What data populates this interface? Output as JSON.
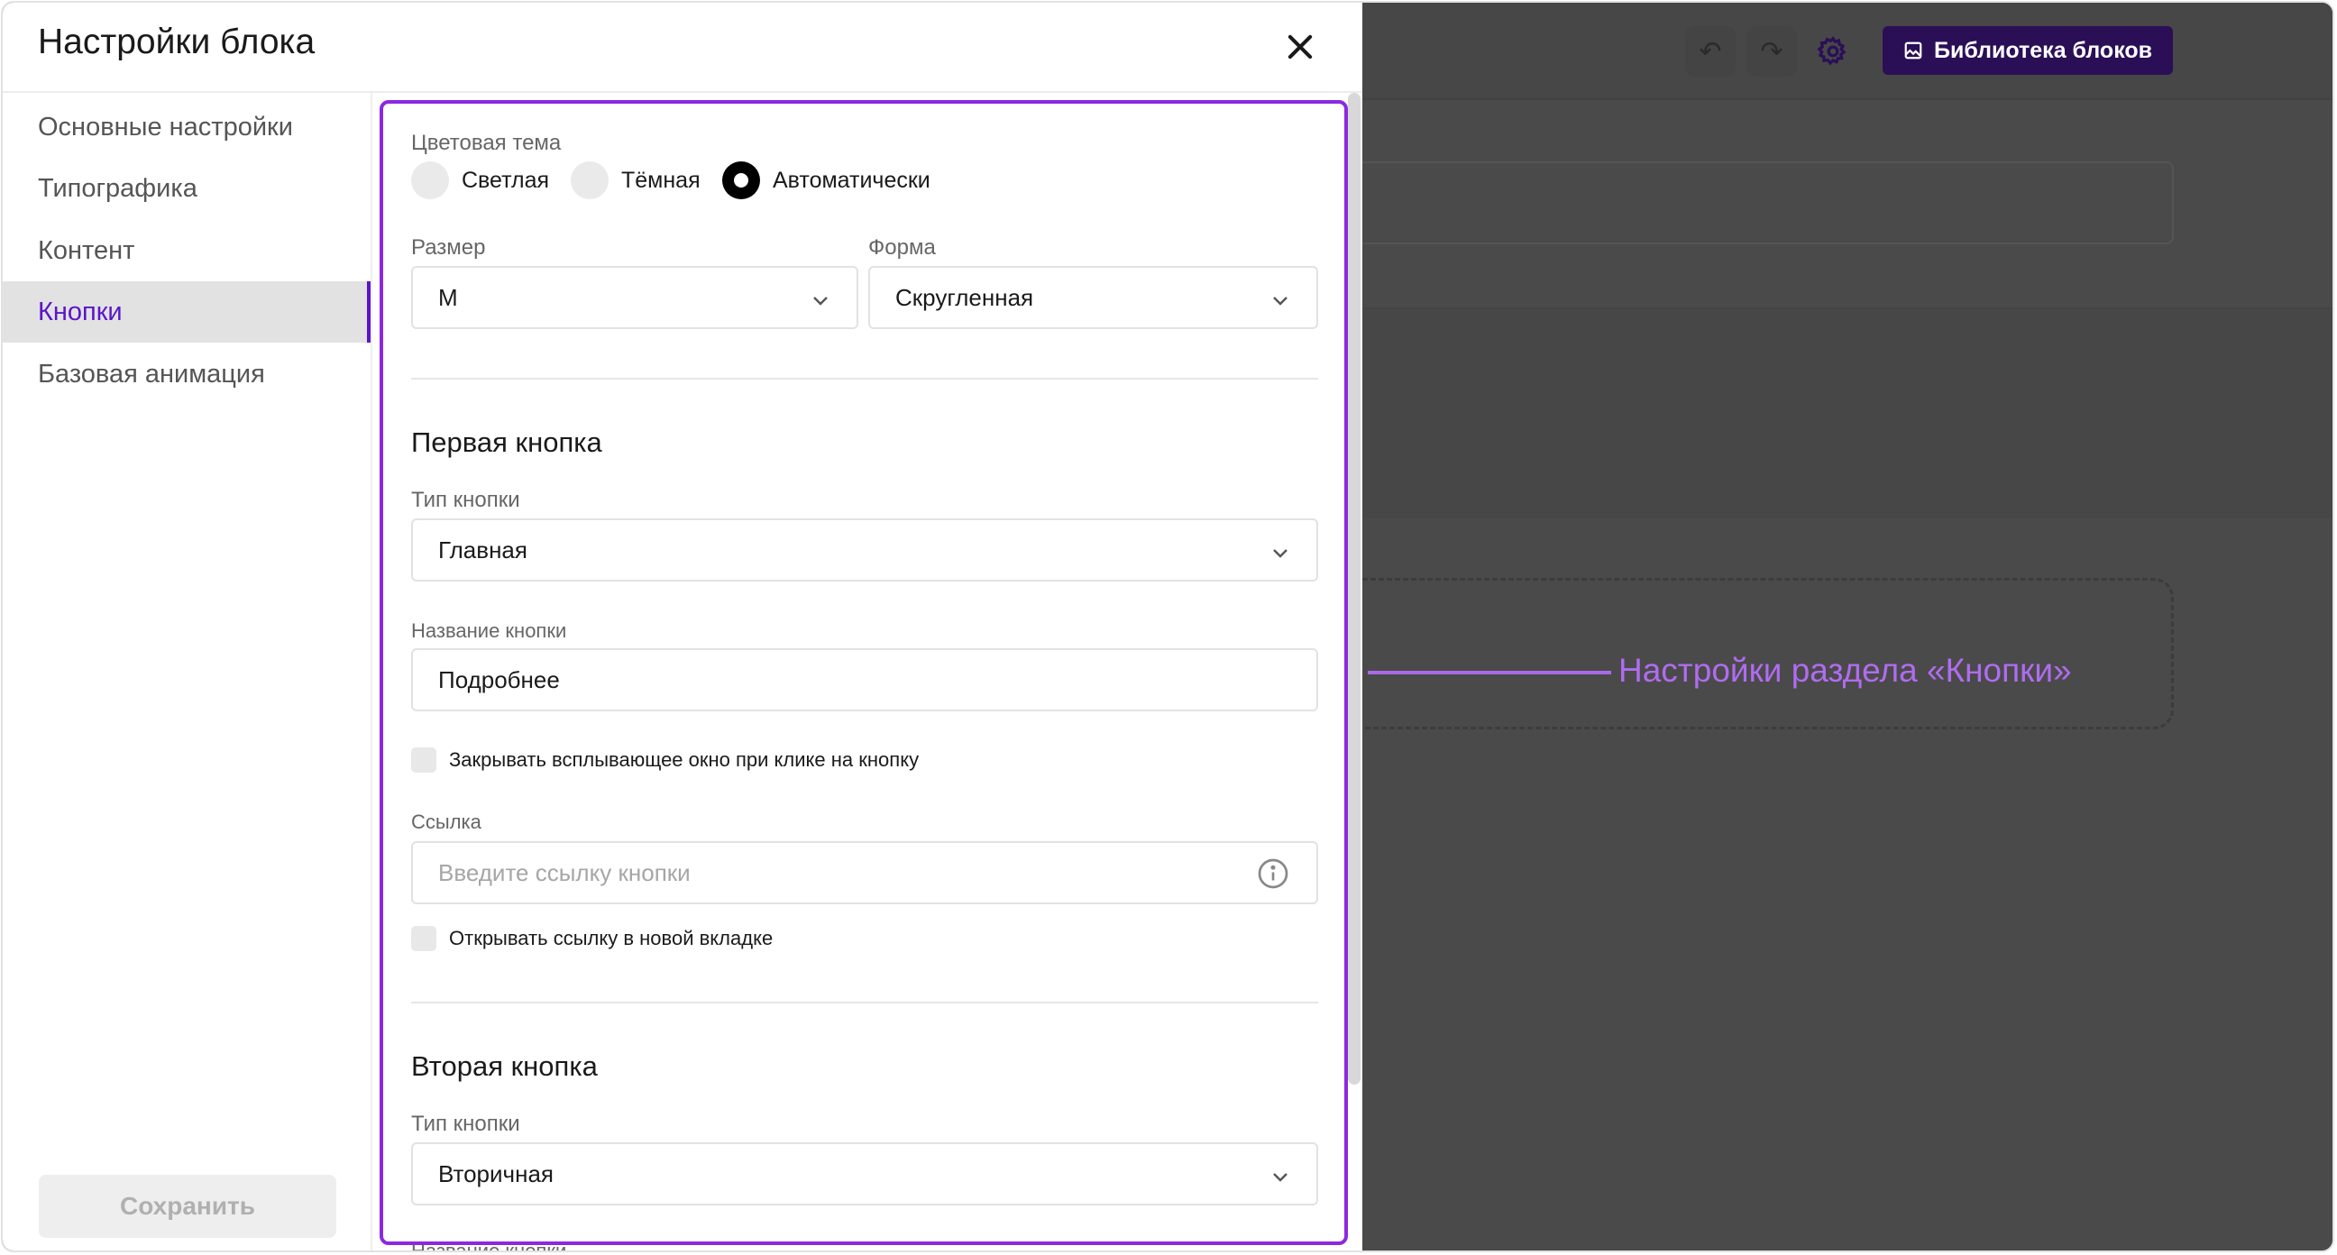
{
  "background": {
    "undo_icon": "↶",
    "redo_icon": "↷",
    "library_button": "Библиотека блоков",
    "annotation": "Настройки раздела «Кнопки»"
  },
  "modal": {
    "title": "Настройки блока",
    "sidebar": {
      "items": [
        {
          "label": "Основные настройки",
          "active": false
        },
        {
          "label": "Типографика",
          "active": false
        },
        {
          "label": "Контент",
          "active": false
        },
        {
          "label": "Кнопки",
          "active": true
        },
        {
          "label": "Базовая анимация",
          "active": false
        }
      ],
      "save_label": "Сохранить"
    },
    "content": {
      "color_theme": {
        "label": "Цветовая тема",
        "options": [
          "Светлая",
          "Тёмная",
          "Автоматически"
        ],
        "selected": "Автоматически"
      },
      "size": {
        "label": "Размер",
        "value": "M"
      },
      "shape": {
        "label": "Форма",
        "value": "Скругленная"
      },
      "first_button": {
        "heading": "Первая кнопка",
        "type_label": "Тип кнопки",
        "type_value": "Главная",
        "name_label": "Название кнопки",
        "name_value": "Подробнее",
        "close_popup_label": "Закрывать всплывающее окно при клике на кнопку",
        "link_label": "Ссылка",
        "link_placeholder": "Введите ссылку кнопки",
        "new_tab_label": "Открывать ссылку в новой вкладке"
      },
      "second_button": {
        "heading": "Вторая кнопка",
        "type_label": "Тип кнопки",
        "type_value": "Вторичная",
        "name_label": "Название кнопки"
      }
    }
  },
  "colors": {
    "accent": "#5b15c9",
    "highlight": "#8d28e0",
    "annotation": "#b06cf0"
  }
}
